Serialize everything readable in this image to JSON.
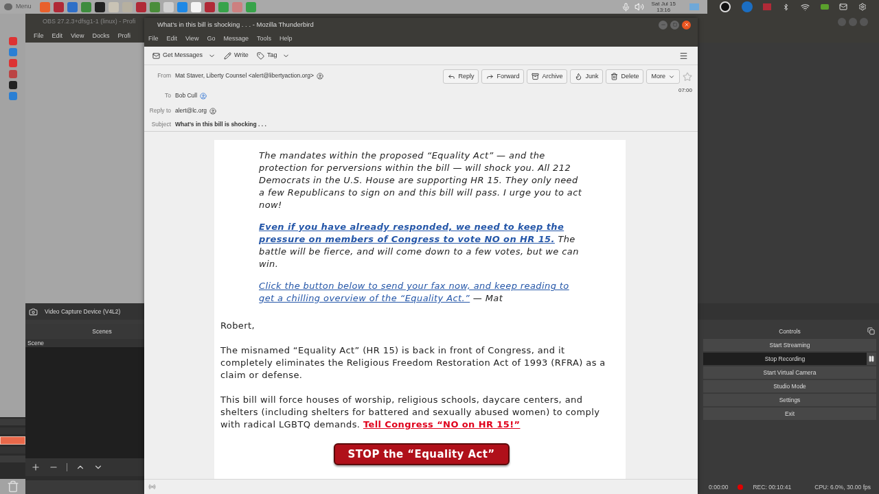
{
  "panel": {
    "menu": "Menu",
    "date": "Sat Jul 15",
    "time": "13:16"
  },
  "obs": {
    "title": "OBS 27.2.3+dfsg1-1 (linux) - Profi",
    "menus": [
      "File",
      "Edit",
      "View",
      "Docks",
      "Profi"
    ],
    "source": "Video Capture Device (V4L2)",
    "scenes_title": "Scenes",
    "scenes": [
      {
        "label": "Scene",
        "selected": true
      }
    ],
    "controls_title": "Controls",
    "controls": [
      {
        "label": "Start Streaming",
        "active": false
      },
      {
        "label": "Stop Recording",
        "active": true
      },
      {
        "label": "Start Virtual Camera",
        "active": false
      },
      {
        "label": "Studio Mode",
        "active": false
      },
      {
        "label": "Settings",
        "active": false
      },
      {
        "label": "Exit",
        "active": false
      }
    ],
    "status": {
      "elapsed": "0:00:00",
      "recording": true,
      "rec": "REC: 00:10:41",
      "cpu": "CPU: 6.0%, 30.00 fps"
    }
  },
  "thunderbird": {
    "title": "What’s in this bill is shocking . . . - Mozilla Thunderbird",
    "menus": [
      "File",
      "Edit",
      "View",
      "Go",
      "Message",
      "Tools",
      "Help"
    ],
    "toolbar": [
      {
        "label": "Get Messages",
        "dropdown": true
      },
      {
        "label": "Write",
        "dropdown": false
      },
      {
        "label": "Tag",
        "dropdown": true
      }
    ],
    "fields": [
      {
        "label": "From",
        "value": "Mat Staver, Liberty Counsel <alert@libertyaction.org>",
        "kind": "contact"
      },
      {
        "label": "To",
        "value": "Bob Cull",
        "kind": "known_contact"
      },
      {
        "label": "Reply to",
        "value": "alert@lc.org",
        "kind": "contact"
      },
      {
        "label": "Subject",
        "value": "What’s in this bill is shocking . . .",
        "kind": "subject"
      }
    ],
    "actions": [
      {
        "label": "Reply",
        "dropdown": false
      },
      {
        "label": "Forward",
        "dropdown": false
      },
      {
        "label": "Archive",
        "dropdown": false
      },
      {
        "label": "Junk",
        "dropdown": false
      },
      {
        "label": "Delete",
        "dropdown": false
      },
      {
        "label": "More",
        "dropdown": true
      }
    ],
    "starred": false,
    "time": "07:00",
    "body": [
      {
        "kind": "intro",
        "parts": [
          {
            "kind": "text",
            "text": "The mandates within the proposed “Equality Act” — and the protection for perversions within the bill — will shock you. All 212 Democrats in the U.S. House are supporting HR 15. They only need a few Republicans to sign on and this bill will pass. I urge you to act now!"
          }
        ]
      },
      {
        "kind": "intro",
        "parts": [
          {
            "kind": "strong_link",
            "text": "Even if you have already responded, we need to keep the pressure on members of Congress to vote NO on HR 15."
          },
          {
            "kind": "text",
            "text": " The battle will be fierce, and will come down to a few votes, but we can win."
          }
        ]
      },
      {
        "kind": "intro",
        "parts": [
          {
            "kind": "link",
            "text": "Click the button below to send your fax now, and keep reading to get a chilling overview of the “Equality Act.”"
          },
          {
            "kind": "text",
            "text": " — Mat"
          }
        ]
      },
      {
        "kind": "salutation",
        "parts": [
          {
            "kind": "text",
            "text": "Robert,"
          }
        ]
      },
      {
        "kind": "normal",
        "parts": [
          {
            "kind": "text",
            "text": "The misnamed “Equality Act” (HR 15) is back in front of Congress, and it completely eliminates the Religious Freedom Restoration Act of 1993 (RFRA) as a claim or defense."
          }
        ]
      },
      {
        "kind": "normal",
        "parts": [
          {
            "kind": "text",
            "text": "This bill will force houses of worship, religious schools, daycare centers, and shelters (including shelters for battered and sexually abused women) to comply with radical LGBTQ demands. "
          },
          {
            "kind": "alert_link",
            "text": "Tell Congress “NO on HR 15!”"
          }
        ]
      }
    ],
    "cta": "STOP the “Equality Act”"
  }
}
